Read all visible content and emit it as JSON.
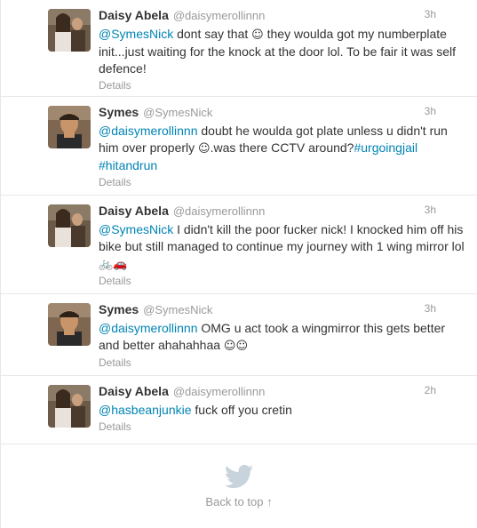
{
  "tweets": [
    {
      "fullname": "Daisy Abela",
      "username": "@daisymerollinnn",
      "time": "3h",
      "mention": "@SymesNick",
      "text_before_emoji": " dont say that ",
      "emoji": "☺",
      "text_after": " they woulda got my numberplate init...just waiting for the knock at the door lol. To be fair it was self defence!",
      "details": "Details"
    },
    {
      "fullname": "Symes",
      "username": "@SymesNick",
      "time": "3h",
      "mention": "@daisymerollinnn",
      "text_before_emoji": " doubt he woulda got plate unless u didn't run him over properly ",
      "emoji": "☺",
      "text_after": ".was there CCTV around?",
      "hashtag1": "#urgoingjail",
      "hashtag2": "#hitandrun",
      "details": "Details"
    },
    {
      "fullname": "Daisy Abela",
      "username": "@daisymerollinnn",
      "time": "3h",
      "mention": "@SymesNick",
      "text": " I didn't kill the poor fucker nick! I knocked him off his bike but still managed to continue my journey with 1 wing mirror lol ",
      "emoji": "🚲🚗",
      "details": "Details"
    },
    {
      "fullname": "Symes",
      "username": "@SymesNick",
      "time": "3h",
      "mention": "@daisymerollinnn",
      "text": " OMG u act took a wingmirror this gets better and better ahahahhaa ",
      "emoji": "☺☺",
      "details": "Details"
    },
    {
      "fullname": "Daisy Abela",
      "username": "@daisymerollinnn",
      "time": "2h",
      "mention": "@hasbeanjunkie",
      "text": " fuck off you cretin",
      "details": "Details"
    }
  ],
  "footer": {
    "back_to_top": "Back to top ↑"
  },
  "colors": {
    "link": "#0084b4",
    "muted": "#999999",
    "bird": "#c8d3dc"
  }
}
